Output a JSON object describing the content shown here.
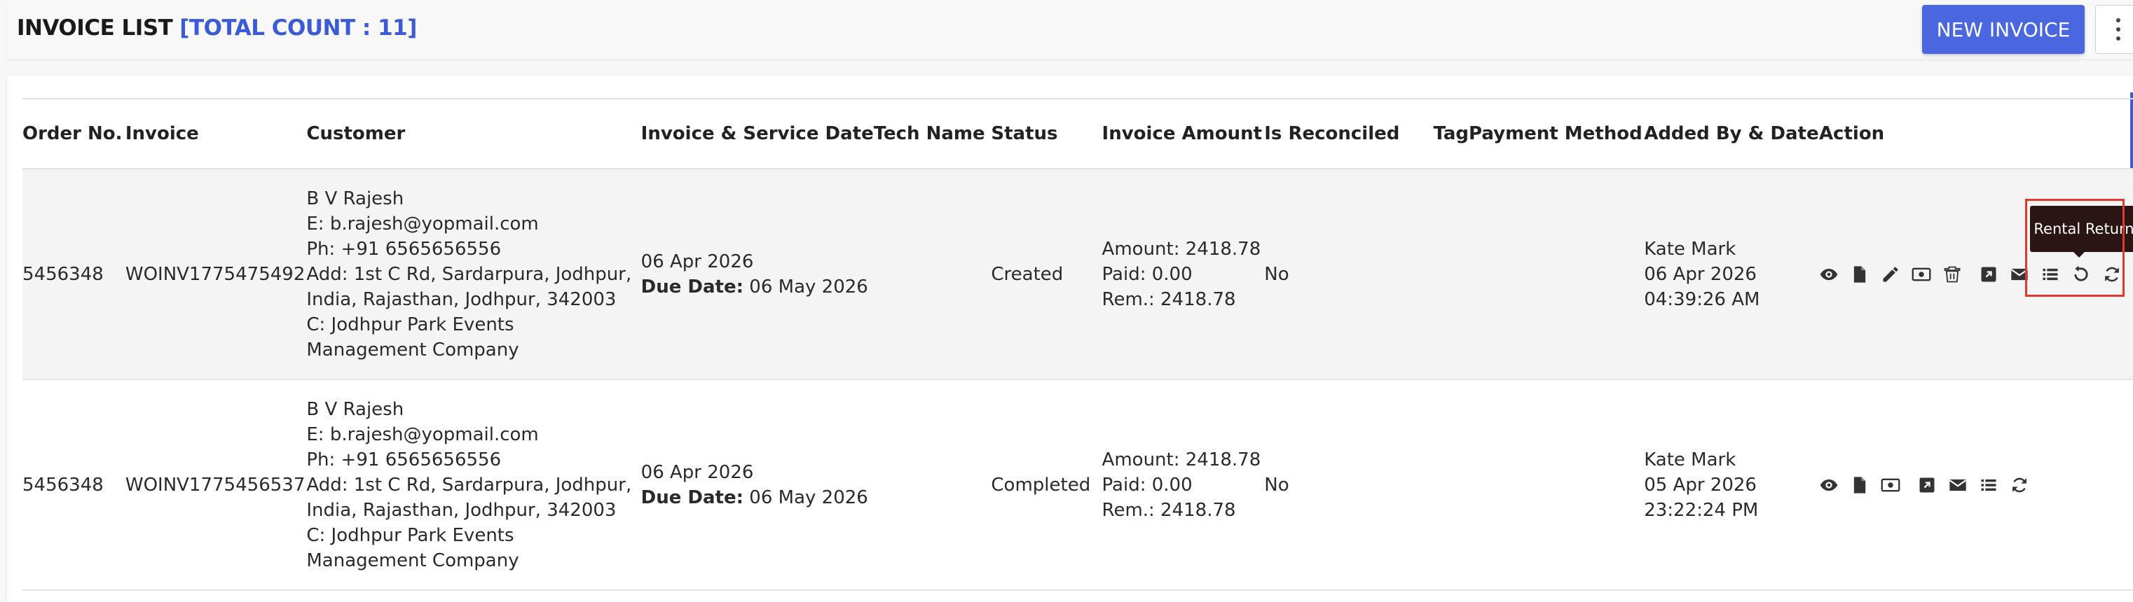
{
  "header": {
    "title": "INVOICE LIST",
    "count_label": "[TOTAL COUNT : 11]",
    "new_invoice_label": "NEW INVOICE"
  },
  "table": {
    "columns": [
      "Order No.",
      "Invoice",
      "Customer",
      "Invoice & Service Date",
      "Tech Name",
      "Status",
      "Invoice Amount",
      "Is Reconciled",
      "Tag",
      "Payment Method",
      "Added By & Date",
      "Action"
    ],
    "rows": [
      {
        "order_no": "5456348",
        "invoice": "WOINV1775475492",
        "customer": {
          "name": "B V Rajesh",
          "email": "E: b.rajesh@yopmail.com",
          "phone": "Ph: +91 6565656556",
          "addr1": "Add: 1st C Rd, Sardarpura, Jodhpur,",
          "addr2": "India, Rajasthan, Jodhpur, 342003",
          "company1": "C: Jodhpur Park Events",
          "company2": "Management Company"
        },
        "invoice_date": "06 Apr 2026",
        "due_label": "Due Date:",
        "due_date": "06 May 2026",
        "tech_name": "",
        "status": "Created",
        "amount": "Amount: 2418.78",
        "paid": "Paid: 0.00",
        "rem": "Rem.: 2418.78",
        "reconciled": "No",
        "tag": "",
        "payment_method": "",
        "added_by": "Kate Mark",
        "added_date": "06 Apr 2026",
        "added_time": "04:39:26 AM"
      },
      {
        "order_no": "5456348",
        "invoice": "WOINV1775456537",
        "customer": {
          "name": "B V Rajesh",
          "email": "E: b.rajesh@yopmail.com",
          "phone": "Ph: +91 6565656556",
          "addr1": "Add: 1st C Rd, Sardarpura, Jodhpur,",
          "addr2": "India, Rajasthan, Jodhpur, 342003",
          "company1": "C: Jodhpur Park Events",
          "company2": "Management Company"
        },
        "invoice_date": "06 Apr 2026",
        "due_label": "Due Date:",
        "due_date": "06 May 2026",
        "tech_name": "",
        "status": "Completed",
        "amount": "Amount: 2418.78",
        "paid": "Paid: 0.00",
        "rem": "Rem.: 2418.78",
        "reconciled": "No",
        "tag": "",
        "payment_method": "",
        "added_by": "Kate Mark",
        "added_date": "05 Apr 2026",
        "added_time": "23:22:24 PM"
      }
    ]
  },
  "tooltip": {
    "text": "Rental Return"
  },
  "colors": {
    "accent": "#3b5bd6",
    "button": "#4a67e0",
    "highlight": "#e03a2f"
  }
}
